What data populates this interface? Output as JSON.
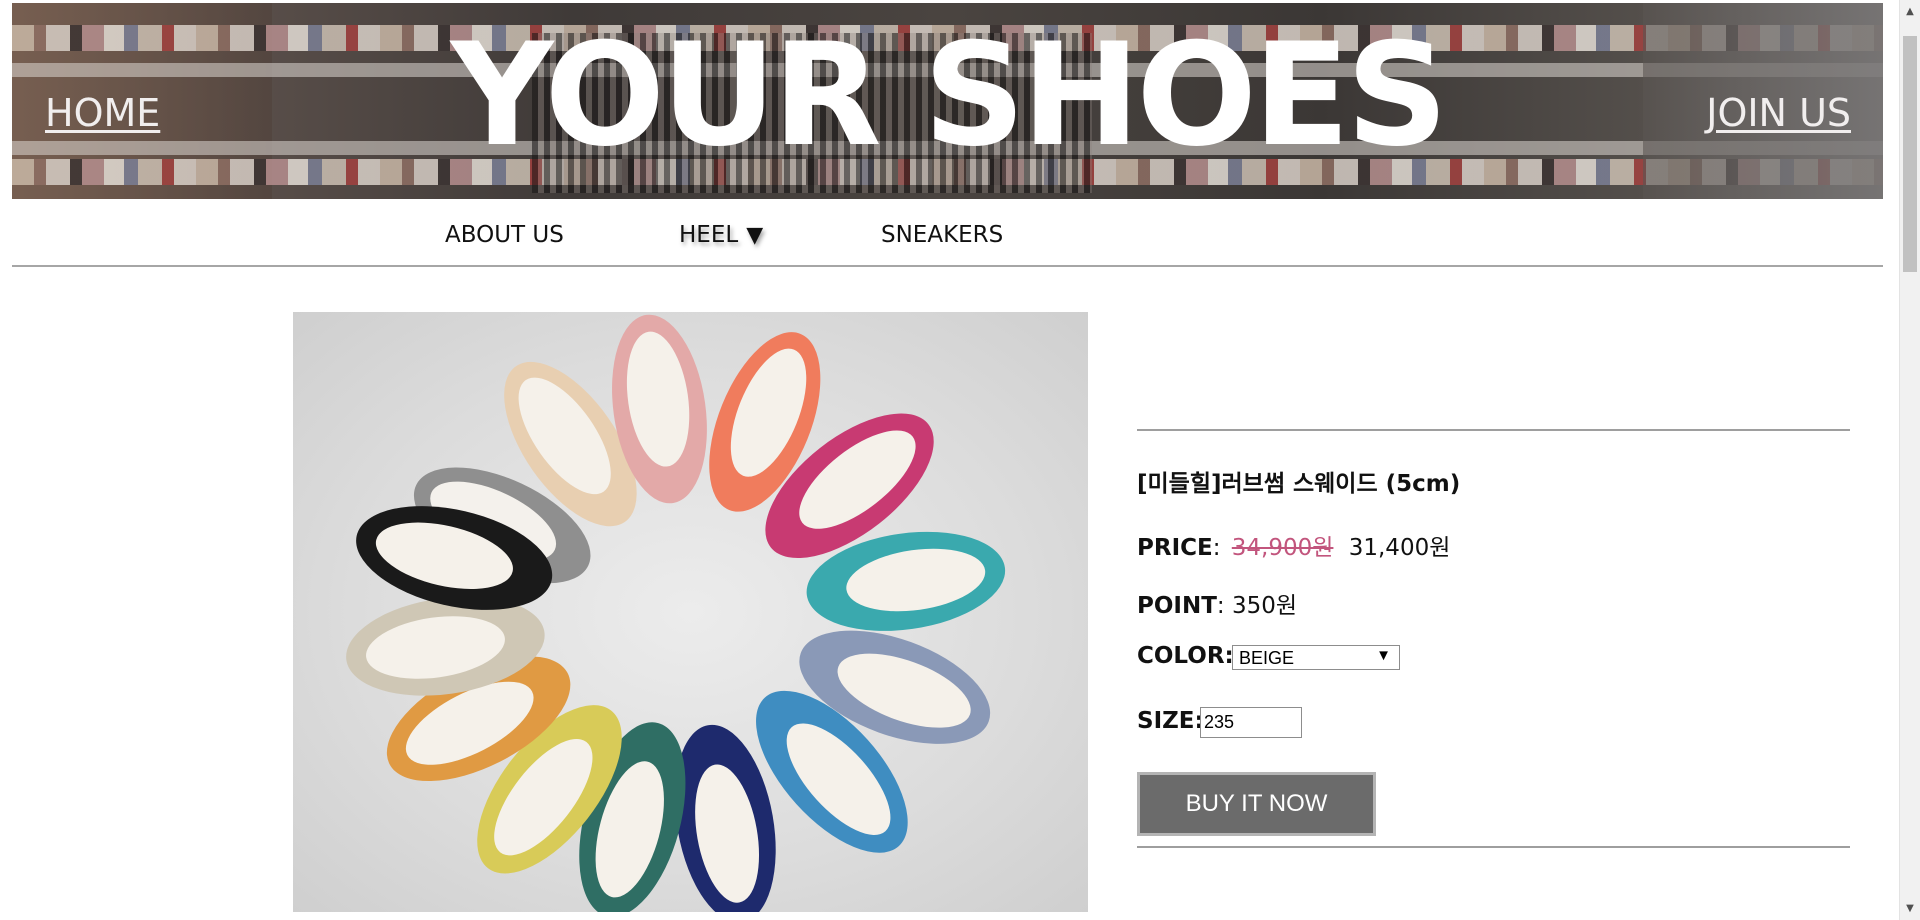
{
  "header": {
    "home_label": "HOME",
    "title": "YOUR SHOES",
    "join_label": "JOIN US"
  },
  "nav": {
    "items": [
      {
        "label": "ABOUT US"
      },
      {
        "label": "HEEL",
        "caret": "▼"
      },
      {
        "label": "SNEAKERS"
      }
    ]
  },
  "product": {
    "name": "[미들힐]러브썸 스웨이드 (5cm)",
    "price_label": "PRICE",
    "old_price": "34,900원",
    "new_price": "31,400원",
    "point_label": "POINT",
    "point_value": "350원",
    "color_label": "COLOR:",
    "color_selected": "BEIGE",
    "size_label": "SIZE:",
    "size_value": "235",
    "buy_label": "BUY IT NOW"
  },
  "colors": {
    "old_price": "#c2557d",
    "buy_button": "#6b6b6b"
  }
}
